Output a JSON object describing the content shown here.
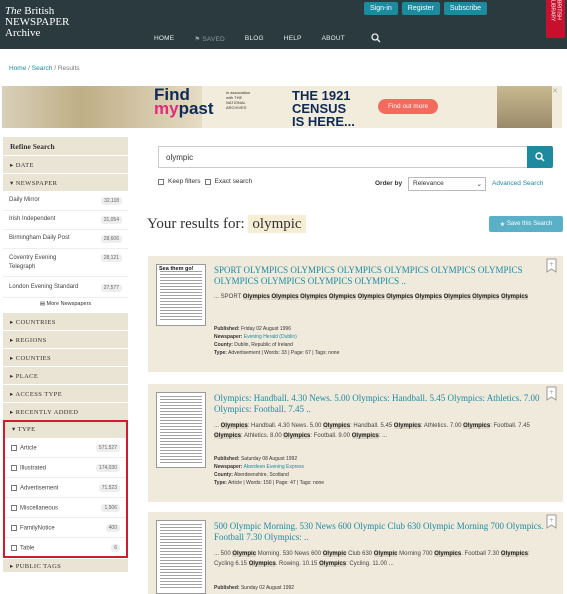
{
  "header": {
    "logo_line1_the": "The",
    "logo_line1_rest": "British",
    "logo_line2": "NEWSPAPER",
    "logo_line3": "Archive",
    "auth_buttons": [
      "Sign-in",
      "Register",
      "Subscribe"
    ],
    "badge": "BRITISH LIBRARY",
    "nav": [
      "HOME",
      "SAVED",
      "BLOG",
      "HELP",
      "ABOUT"
    ]
  },
  "breadcrumb": [
    "Home",
    "Search",
    "Results"
  ],
  "ad": {
    "find": "Find",
    "my": "my",
    "past": "past",
    "assoc": "in association with THE NATIONAL ARCHIVES",
    "census_l1": "THE 1921",
    "census_l2": "CENSUS",
    "census_l3": "IS HERE...",
    "button": "Find out more"
  },
  "sidebar": {
    "title": "Refine Search",
    "date": "DATE",
    "newspaper": "NEWSPAPER",
    "papers": [
      {
        "name": "Daily Mirror",
        "count": "32,118"
      },
      {
        "name": "Irish Independent",
        "count": "31,054"
      },
      {
        "name": "Birmingham Daily Post",
        "count": "28,606"
      },
      {
        "name": "Coventry Evening Telegraph",
        "count": "28,121"
      },
      {
        "name": "London Evening Standard",
        "count": "27,577"
      }
    ],
    "more": "More Newspapers",
    "sections": [
      "COUNTRIES",
      "REGIONS",
      "COUNTIES",
      "PLACE",
      "ACCESS TYPE",
      "RECENTLY ADDED"
    ],
    "type_label": "TYPE",
    "types": [
      {
        "name": "Article",
        "count": "571,527"
      },
      {
        "name": "Illustrated",
        "count": "174,030"
      },
      {
        "name": "Advertisement",
        "count": "71,523"
      },
      {
        "name": "Miscellaneous",
        "count": "1,506"
      },
      {
        "name": "FamilyNotice",
        "count": "400"
      },
      {
        "name": "Table",
        "count": "6"
      }
    ],
    "public_tags": "PUBLIC TAGS"
  },
  "search": {
    "query": "olympic",
    "keep_filters": "Keep filters",
    "exact_search": "Exact search",
    "order_by_label": "Order by",
    "order_value": "Relevance",
    "advanced": "Advanced Search",
    "results_for": "Your results for:",
    "save": "Save this Search"
  },
  "results": [
    {
      "thumb_head": "Sea them go!",
      "title": "SPORT OLYMPICS OLYMPICS OLYMPICS OLYMPICS OLYMPICS OLYMPICS OLYMPICS OLYMPICS OLYMPICS OLYMPICS ..",
      "snippet_pre": "... SPORT",
      "snippet_terms": [
        "Olympics",
        "Olympics",
        "Olympics",
        "Olympics",
        "Olympics",
        "Olympics",
        "Olympics",
        "Olympics",
        "Olympics",
        "Olympics"
      ],
      "published": "Friday 02 August 1996",
      "newspaper": "Evening Herald (Dublin)",
      "county": "Dublin, Republic of Ireland",
      "type_line": "Advertisement | Words: 33 | Page: 67 | Tags: none"
    },
    {
      "title": "Olympics: Handball. 4.30 News. 5.00 Olympics: Handball. 5.45 Olympics: Athletics. 7.00 Olympics: Football. 7.45 ..",
      "published": "Saturday 08 August 1992",
      "newspaper": "Aberdeen Evening Express",
      "county": "Aberdeenshire, Scotland",
      "type_line": "Article | Words: 150 | Page: 47 | Tags: none"
    },
    {
      "title": "500 Olympic Morning. 530 News 600 Olympic Club 630 Olympic Morning 700 Olympics. Football 7.30 Olympics: ..",
      "published": "Sunday 02 August 1992"
    }
  ]
}
